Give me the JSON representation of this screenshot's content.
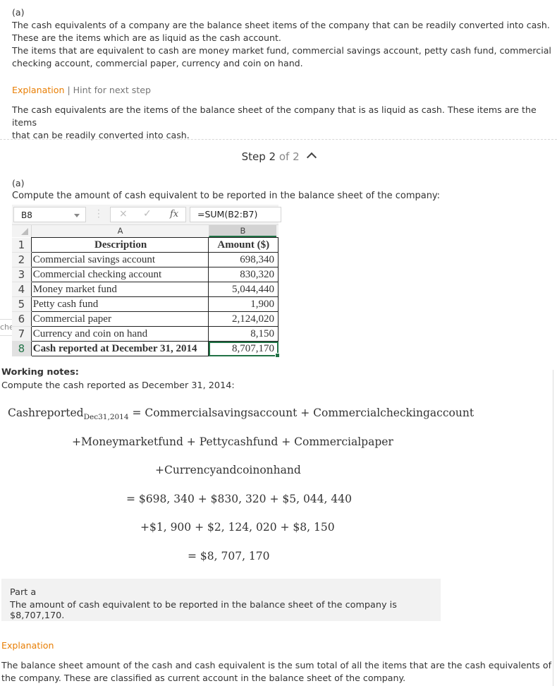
{
  "step1": {
    "part_label": "(a)",
    "paragraph_lines": [
      "The cash equivalents of a company are the balance sheet items of the company that can be readily converted into cash.",
      "These are the items which are as liquid as the cash account.",
      "The items that are equivalent to cash are money market fund, commercial savings account, petty cash fund, commercial",
      "checking account, commercial paper, currency and coin on hand."
    ],
    "explanation_link": "Explanation",
    "separator": "|",
    "hint_link": "Hint for next step",
    "explanation_lines": [
      "The cash equivalents are the items of the balance sheet of the company that is as liquid as cash. These items are the items",
      "that can be readily converted into cash."
    ]
  },
  "step_header": {
    "prefix": "Step",
    "current": "2",
    "of_text": "of 2",
    "icon": "chevron-up-icon"
  },
  "step2": {
    "part_label": "(a)",
    "instruction": "Compute the amount of cash equivalent to be reported in the balance sheet of the company:",
    "spreadsheet": {
      "name_box": "B8",
      "cancel_icon": "×",
      "enter_icon": "✓",
      "fx_icon": "fx",
      "formula": "=SUM(B2:B7)",
      "column_headers": [
        "A",
        "B"
      ],
      "rows": [
        {
          "num": "1",
          "a": "Description",
          "b": "Amount ($)"
        },
        {
          "num": "2",
          "a": "Commercial savings account",
          "b": "698,340"
        },
        {
          "num": "3",
          "a": "Commercial checking account",
          "b": "830,320"
        },
        {
          "num": "4",
          "a": "Money market fund",
          "b": "5,044,440"
        },
        {
          "num": "5",
          "a": "Petty cash fund",
          "b": "1,900"
        },
        {
          "num": "6",
          "a": "Commercial paper",
          "b": "2,124,020"
        },
        {
          "num": "7",
          "a": "Currency and coin on hand",
          "b": "8,150"
        },
        {
          "num": "8",
          "a": "Cash reported at December 31, 2014",
          "b": "8,707,170"
        }
      ]
    },
    "side_fragment": "che",
    "working_notes_title": "Working notes:",
    "working_notes_sub": "Compute the cash reported as December 31, 2014:",
    "equation": {
      "lhs": "Cashreported",
      "lhs_sub": "Dec31,2014",
      "line1_rhs": "= Commercialsavingsaccount + Commercialcheckingaccount",
      "line2": "+Moneymarketfund + Pettycashfund + Commercialpaper",
      "line3": "+Currencyandcoinonhand",
      "line4": "= $698, 340 + $830, 320 + $5, 044, 440",
      "line5": "+$1, 900 + $2, 124, 020 + $8, 150",
      "line6": "= $8, 707, 170"
    },
    "answer_box": {
      "title": "Part a",
      "text": "The amount of cash equivalent to be reported in the balance sheet of the company is $8,707,170."
    },
    "explanation_label": "Explanation",
    "explanation_lines": [
      "The balance sheet amount of the cash and cash equivalent is the sum total of all the items that are the cash equivalents of",
      "the company. These are classified as current account in the balance sheet of the company."
    ]
  },
  "colors": {
    "accent_orange": "#e87e04",
    "excel_green": "#217346",
    "answer_bg": "#f2f2f2"
  }
}
